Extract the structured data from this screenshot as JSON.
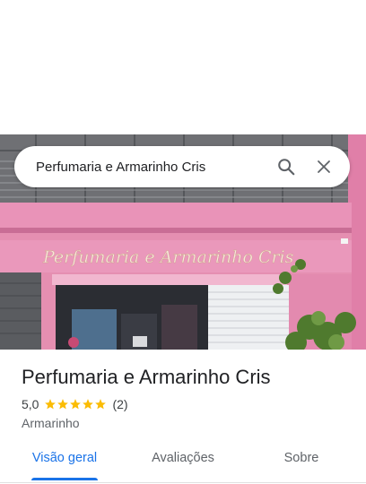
{
  "search": {
    "query": "Perfumaria e Armarinho Cris"
  },
  "photo": {
    "sign_text": "Perfumaria e Armarinho Cris"
  },
  "place": {
    "name": "Perfumaria e Armarinho Cris",
    "rating": "5,0",
    "stars": 5,
    "review_count": "(2)",
    "category": "Armarinho"
  },
  "tabs": [
    {
      "label": "Visão geral",
      "active": true
    },
    {
      "label": "Avaliações",
      "active": false
    },
    {
      "label": "Sobre",
      "active": false
    }
  ],
  "colors": {
    "accent": "#1a73e8",
    "star": "#fbbc04",
    "storefront_pink": "#e58fb1"
  },
  "icons": [
    "search-icon",
    "close-icon",
    "star-icon"
  ]
}
